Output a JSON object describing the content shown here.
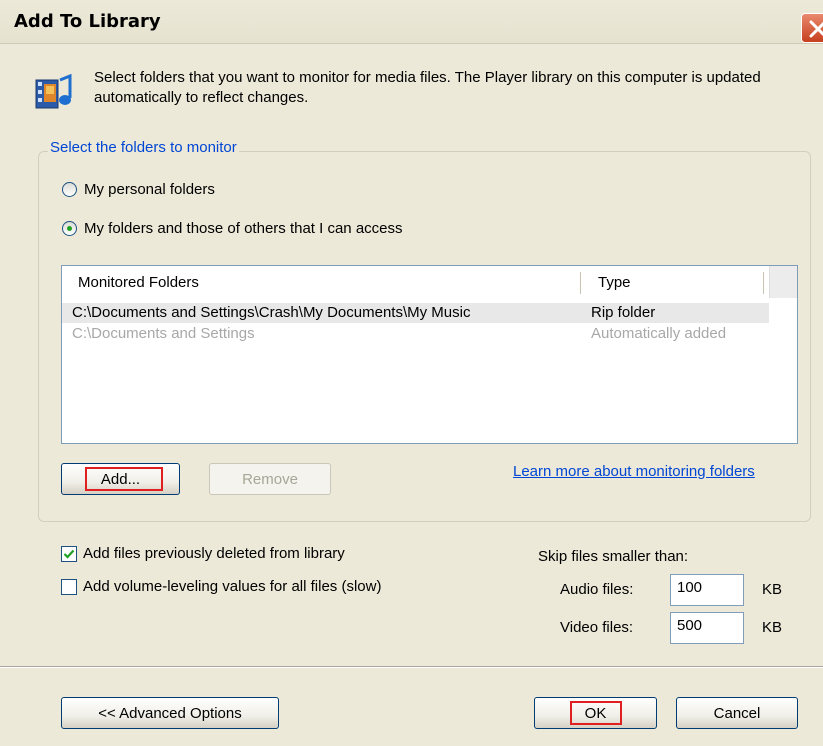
{
  "window": {
    "title": "Add To Library"
  },
  "intro": {
    "text": "Select folders that you want to monitor for media files. The Player library on this computer is updated automatically to reflect changes."
  },
  "monitor_group": {
    "legend": "Select the folders to monitor",
    "options": [
      {
        "label": "My personal folders",
        "selected": false
      },
      {
        "label": "My folders and those of others that I can access",
        "selected": true
      }
    ]
  },
  "folder_list": {
    "columns": [
      "Monitored Folders",
      "Type"
    ],
    "rows": [
      {
        "folder": "C:\\Documents and Settings\\Crash\\My Documents\\My Music",
        "type": "Rip folder",
        "selected": true,
        "dim": false
      },
      {
        "folder": "C:\\Documents and Settings",
        "type": "Automatically added",
        "selected": false,
        "dim": true
      }
    ]
  },
  "buttons": {
    "add": "Add...",
    "remove": "Remove",
    "advanced": "<< Advanced Options",
    "ok": "OK",
    "cancel": "Cancel"
  },
  "learn_more_link": "Learn more about monitoring folders",
  "checkboxes": [
    {
      "label": "Add files previously deleted from library",
      "checked": true
    },
    {
      "label": "Add volume-leveling values for all files (slow)",
      "checked": false
    }
  ],
  "skip": {
    "label": "Skip files smaller than:",
    "audio_label": "Audio files:",
    "audio_value": "100",
    "video_label": "Video files:",
    "video_value": "500",
    "unit": "KB"
  },
  "colors": {
    "dialog_bg": "#ece9d8",
    "link_blue": "#0046d5",
    "focus_red": "#e02020"
  }
}
